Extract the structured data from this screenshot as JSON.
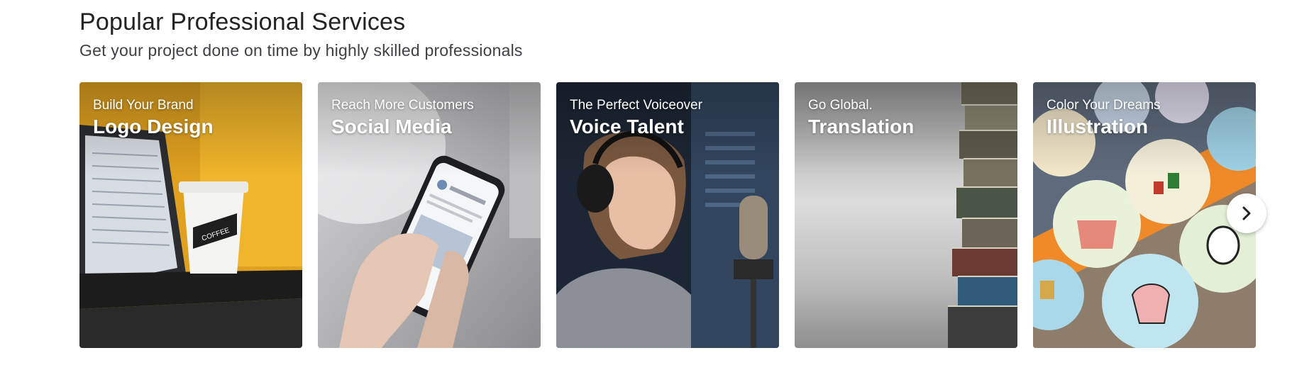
{
  "section": {
    "title": "Popular Professional Services",
    "subtitle": "Get your project done on time by highly skilled professionals"
  },
  "cards": [
    {
      "tagline": "Build Your Brand",
      "title": "Logo Design",
      "accent": "#e9a81e"
    },
    {
      "tagline": "Reach More Customers",
      "title": "Social Media",
      "accent": "#a9a9ab"
    },
    {
      "tagline": "The Perfect Voiceover",
      "title": "Voice Talent",
      "accent": "#2b3646"
    },
    {
      "tagline": "Go Global.",
      "title": "Translation",
      "accent": "#bcbcbc"
    },
    {
      "tagline": "Color Your Dreams",
      "title": "Illustration",
      "accent": "#7fb7d4"
    }
  ],
  "carousel": {
    "next_icon": "chevron-right-icon"
  }
}
